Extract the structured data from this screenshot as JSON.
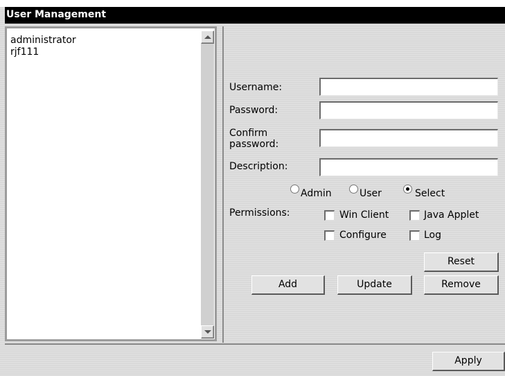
{
  "window": {
    "title": "User Management"
  },
  "users": [
    "administrator",
    "rjf111"
  ],
  "form": {
    "username_label": "Username:",
    "password_label": "Password:",
    "confirm_label_1": "Confirm",
    "confirm_label_2": "password:",
    "description_label": "Description:",
    "username_value": "",
    "password_value": "",
    "confirm_value": "",
    "description_value": ""
  },
  "roles": {
    "admin": "Admin",
    "user": "User",
    "select": "Select",
    "selected": "select"
  },
  "permissions": {
    "label": "Permissions:",
    "win_client": "Win Client",
    "java_applet": "Java Applet",
    "configure": "Configure",
    "log": "Log"
  },
  "buttons": {
    "reset": "Reset",
    "add": "Add",
    "update": "Update",
    "remove": "Remove",
    "apply": "Apply"
  },
  "icons": {
    "scroll_up": "triangle-up-icon",
    "scroll_down": "triangle-down-icon"
  }
}
